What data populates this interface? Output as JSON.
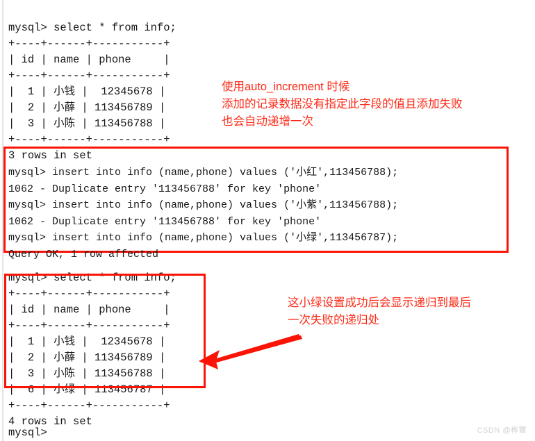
{
  "terminal": {
    "background_color": "#ffffff",
    "text_color": "#18181c",
    "select_query_1": "mysql> select * from info;\n+----+------+-----------+\n| id | name | phone     |\n+----+------+-----------+\n|  1 | 小钱 |  12345678 |\n|  2 | 小薛 | 113456789 |\n|  3 | 小陈 | 113456788 |\n+----+------+-----------+\n3 rows in set",
    "insert_block": "mysql> insert into info (name,phone) values ('小红',113456788);\n1062 - Duplicate entry '113456788' for key 'phone'\nmysql> insert into info (name,phone) values ('小紫',113456788);\n1062 - Duplicate entry '113456788' for key 'phone'\nmysql> insert into info (name,phone) values ('小绿',113456787);\nQuery OK, 1 row affected",
    "select_query_2": "mysql> select * from info;\n+----+------+-----------+\n| id | name | phone     |\n+----+------+-----------+\n|  1 | 小钱 |  12345678 |\n|  2 | 小薛 | 113456789 |\n|  3 | 小陈 | 113456788 |\n|  6 | 小绿 | 113456787 |\n+----+------+-----------+\n4 rows in set",
    "final_prompt": "mysql>"
  },
  "tables": {
    "first_result": {
      "columns": [
        "id",
        "name",
        "phone"
      ],
      "rows": [
        [
          "1",
          "小钱",
          "12345678"
        ],
        [
          "2",
          "小薛",
          "113456789"
        ],
        [
          "3",
          "小陈",
          "113456788"
        ]
      ],
      "row_count_text": "3 rows in set"
    },
    "second_result": {
      "columns": [
        "id",
        "name",
        "phone"
      ],
      "rows": [
        [
          "1",
          "小钱",
          "12345678"
        ],
        [
          "2",
          "小薛",
          "113456789"
        ],
        [
          "3",
          "小陈",
          "113456788"
        ],
        [
          "6",
          "小绿",
          "113456787"
        ]
      ],
      "row_count_text": "4 rows in set"
    }
  },
  "statements": [
    {
      "command": "mysql> insert into info (name,phone) values ('小红',113456788);",
      "result": "1062 - Duplicate entry '113456788' for key 'phone'"
    },
    {
      "command": "mysql> insert into info (name,phone) values ('小紫',113456788);",
      "result": "1062 - Duplicate entry '113456788' for key 'phone'"
    },
    {
      "command": "mysql> insert into info (name,phone) values ('小绿',113456787);",
      "result": "Query OK, 1 row affected"
    }
  ],
  "annotations": {
    "color": "#fd2b17",
    "top_note": "使用auto_increment 时候\n添加的记录数据没有指定此字段的值且添加失败\n也会自动递增一次",
    "bottom_note": "这小绿设置成功后会显示递归到最后\n一次失败的递归处"
  },
  "highlight_boxes": {
    "color": "#fb1405",
    "insert_block_label": "insert-statements-highlight",
    "result_table_label": "result-table-highlight"
  },
  "watermark": {
    "text": "CSDN @桦𬸣"
  }
}
